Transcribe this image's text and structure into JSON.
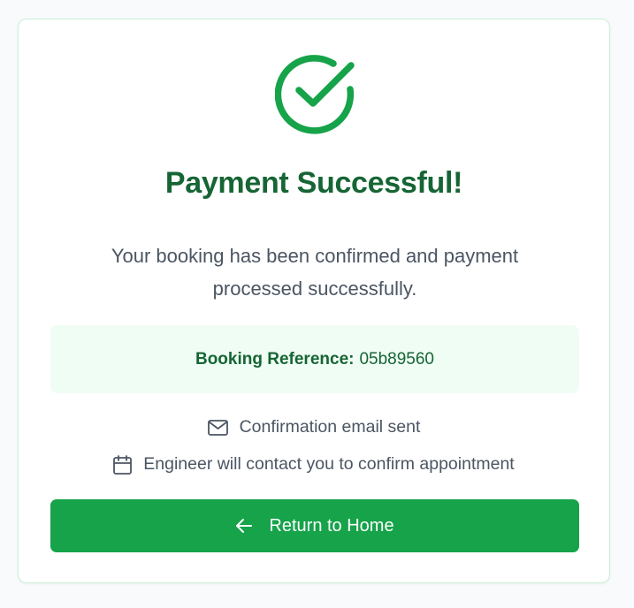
{
  "success": {
    "title": "Payment Successful!",
    "message": "Your booking has been confirmed and payment processed successfully.",
    "icon": "check-circle-icon",
    "accent_color": "#16a34a",
    "title_color": "#166534"
  },
  "booking": {
    "reference_label": "Booking Reference:",
    "reference_value": "05b89560"
  },
  "info": {
    "email_text": "Confirmation email sent",
    "email_icon": "mail-icon",
    "engineer_text": "Engineer will contact you to confirm appointment",
    "engineer_icon": "calendar-icon"
  },
  "actions": {
    "home_label": "Return to Home",
    "home_icon": "arrow-left-icon"
  }
}
